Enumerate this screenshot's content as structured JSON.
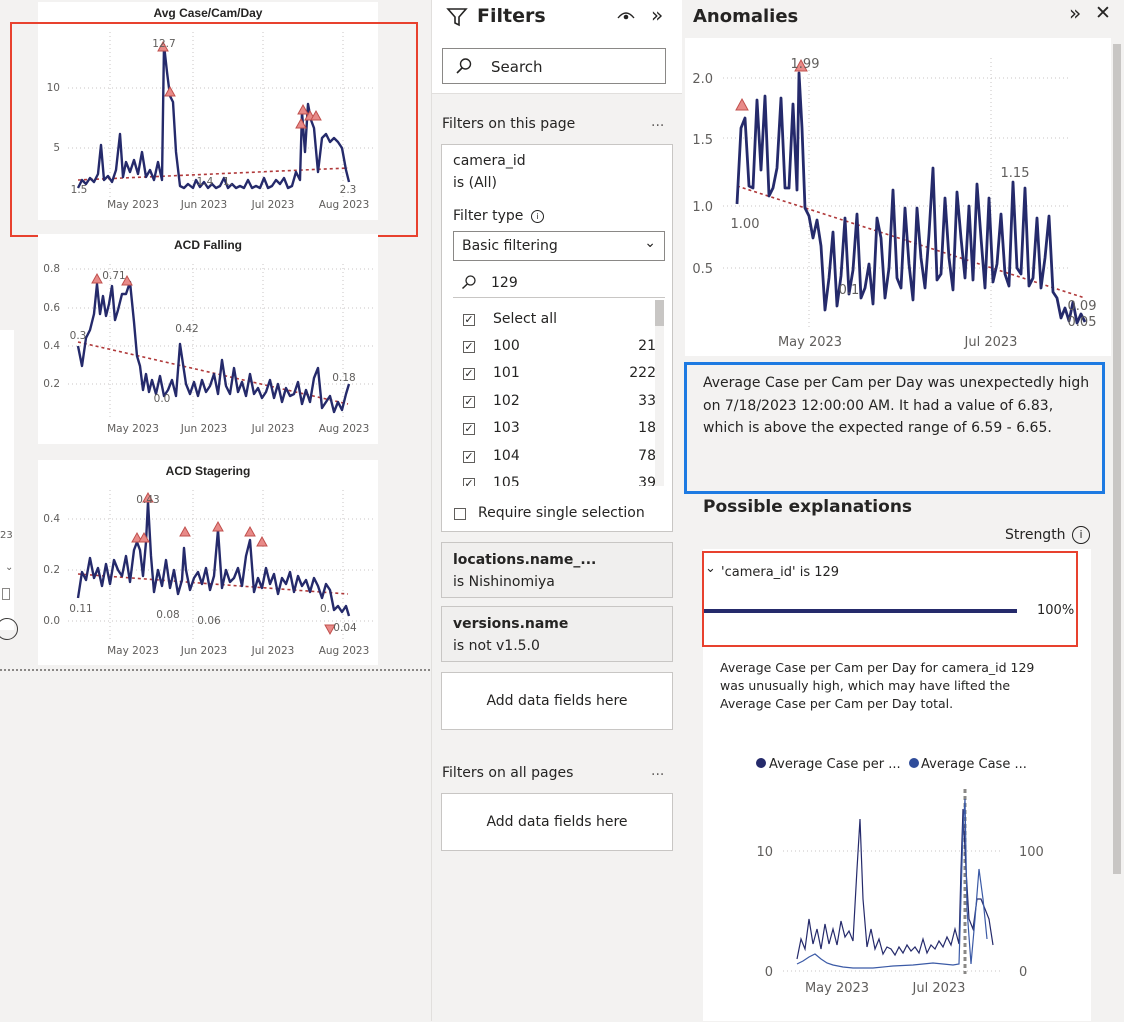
{
  "charts": {
    "avg": {
      "title": "Avg Case/Cam/Day",
      "yticks": [
        "10",
        "5"
      ],
      "xticks": [
        "May 2023",
        "Jun 2023",
        "Jul 2023",
        "Aug 2023"
      ],
      "labels": [
        "12.7",
        "1.5",
        "1.4",
        "1.",
        "2.3"
      ]
    },
    "falling": {
      "title": "ACD Falling",
      "yticks": [
        "0.8",
        "0.6",
        "0.4",
        "0.2"
      ],
      "xticks": [
        "May 2023",
        "Jun 2023",
        "Jul 2023",
        "Aug 2023"
      ],
      "labels": [
        "0.71",
        "0.3",
        "0.42",
        "0.0",
        "0.18"
      ]
    },
    "stagering": {
      "title": "ACD Stagering",
      "yticks": [
        "0.4",
        "0.2",
        "0.0"
      ],
      "xticks": [
        "May 2023",
        "Jun 2023",
        "Jul 2023",
        "Aug 2023"
      ],
      "labels": [
        "0.43",
        "0.11",
        "0.08",
        "0.06",
        "0.",
        "0.04"
      ]
    }
  },
  "left_fragment": {
    "value": "23"
  },
  "filters": {
    "title": "Filters",
    "search_placeholder": "Search",
    "on_this_page": "Filters on this page",
    "more": "...",
    "camera": {
      "field": "camera_id",
      "state": "is (All)",
      "filter_type_label": "Filter type",
      "filter_type_value": "Basic filtering",
      "search_value": "129",
      "select_all": "Select all",
      "items": [
        {
          "label": "100",
          "count": "21"
        },
        {
          "label": "101",
          "count": "222"
        },
        {
          "label": "102",
          "count": "33"
        },
        {
          "label": "103",
          "count": "18"
        },
        {
          "label": "104",
          "count": "78"
        },
        {
          "label": "105",
          "count": "39"
        }
      ],
      "require_single": "Require single selection"
    },
    "locations": {
      "field": "locations.name_...",
      "state": "is Nishinomiya"
    },
    "versions": {
      "field": "versions.name",
      "state": "is not v1.5.0"
    },
    "add_fields": "Add data fields here",
    "on_all_pages": "Filters on all pages",
    "add_fields_all": "Add data fields here"
  },
  "anomalies": {
    "title": "Anomalies",
    "chart": {
      "yticks": [
        "2.0",
        "1.5",
        "1.0",
        "0.5"
      ],
      "xticks": [
        "May 2023",
        "Jul 2023"
      ],
      "labels": [
        "1.99",
        "1.15",
        "1.00",
        "0.1",
        "0.09",
        "0.05"
      ]
    },
    "description": "Average Case per Cam per Day was unexpectedly high on 7/18/2023 12:00:00 AM. It had a value of 6.83, which is above the expected range of 6.59 - 6.65.",
    "possible_explanations": "Possible explanations",
    "strength": "Strength",
    "explanation": {
      "label": "'camera_id' is 129",
      "pct": "100%",
      "strength_fraction": 1.0,
      "detail": "Average Case per Cam per Day for camera_id 129 was unusually high, which may have lifted the Average Case per Cam per Day total.",
      "legend": [
        "Average Case per ...",
        "Average Case ..."
      ],
      "yleft": [
        "10",
        "0"
      ],
      "yright": [
        "100",
        "0"
      ],
      "xticks": [
        "May 2023",
        "Jul 2023"
      ]
    }
  },
  "colors": {
    "line": "#252a6b",
    "trend": "#b0393a",
    "marker": "#e88a88",
    "highlight_red": "#e8412e",
    "highlight_blue": "#1d7ae2"
  }
}
